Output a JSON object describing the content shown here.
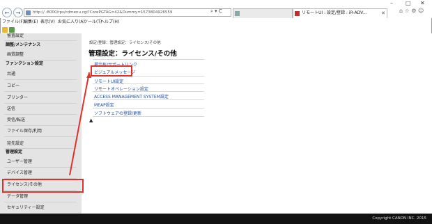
{
  "window": {
    "controls": [
      "–",
      "□",
      "✕"
    ]
  },
  "address": {
    "url": "http://            :8000/rps/cdmenu.cgi?CorePGTAG=42&Dummy=1573804926559",
    "url_icons": "⌕ ▾ C"
  },
  "tabs": [
    {
      "label": "",
      "close": "",
      "active": false
    },
    {
      "label": "リモートUI : 設定/登録 : iR-ADV...",
      "close": "✕",
      "active": true
    }
  ],
  "toolbar_icons": "⌂ ☆ ⚙ ☺",
  "menubar": [
    "ファイル(F)",
    "編集(E)",
    "表示(V)",
    "お気に入り(A)",
    "ツール(T)",
    "ヘルプ(H)"
  ],
  "sidebar": {
    "top_cut": "留置設定",
    "sections": [
      {
        "heading": "調整/メンテナンス",
        "items": [
          "画質調整"
        ]
      },
      {
        "heading": "ファンクション設定",
        "items": [
          "共通",
          "コピー",
          "プリンター",
          "送信",
          "受信/転送",
          "ファイル保存/利用",
          "宛先設定"
        ]
      },
      {
        "heading": "管理設定",
        "items": [
          "ユーザー管理",
          "デバイス管理",
          "ライセンス/その他",
          "データ管理",
          "セキュリティー設定"
        ]
      }
    ]
  },
  "content": {
    "breadcrumb": "設定/登録：管理設定：ライセンス/その他",
    "title": "管理設定：ライセンス/その他",
    "links": [
      "掲示板/サポートリンク",
      "ビジュアルメッセージ",
      "リモートUI設定",
      "リモートオペレーション設定",
      "ACCESS MANAGEMENT SYSTEM設定",
      "MEAP設定",
      "ソフトウェアの登録/更新"
    ],
    "to_top": "▲"
  },
  "footer": {
    "copyright": "Copyright CANON INC. 2015"
  },
  "colors": {
    "accent": "#e0302a",
    "link": "#1b4a9b",
    "sidebar_bg": "#e4e4e4",
    "footer_bg": "#121212"
  }
}
